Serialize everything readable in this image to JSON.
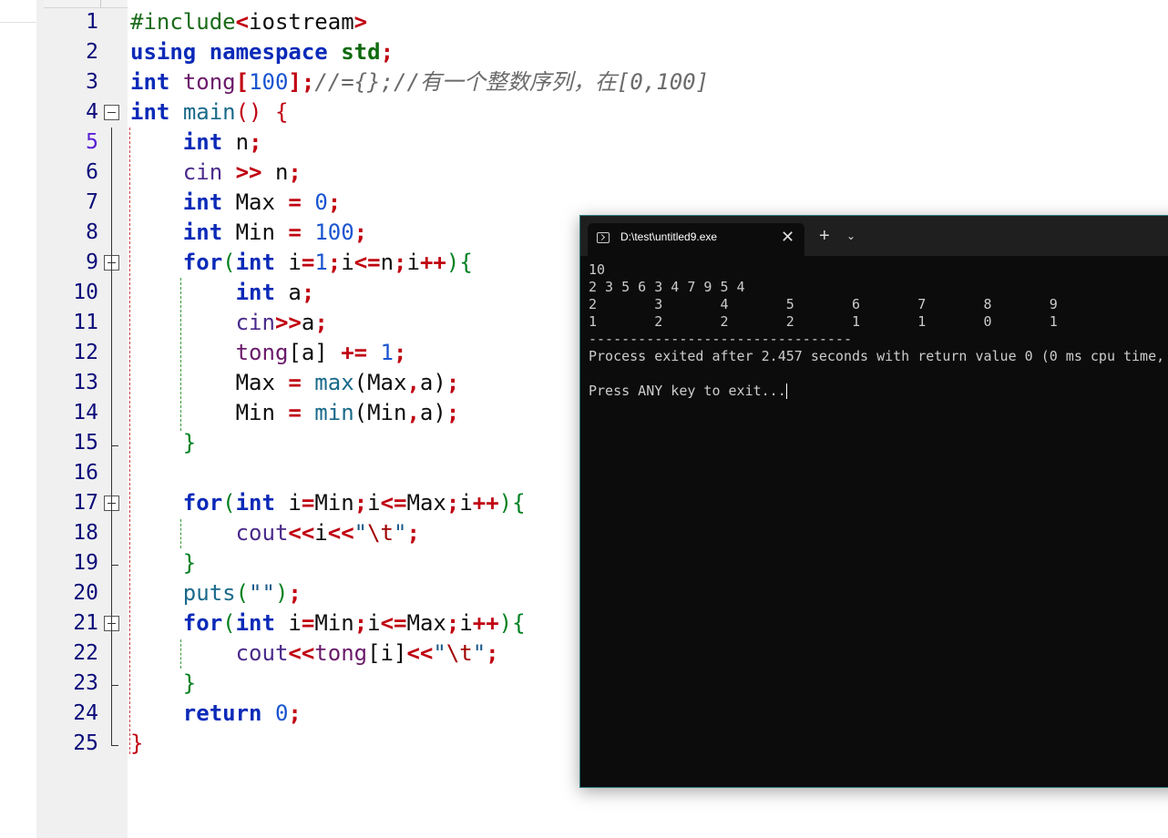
{
  "editor": {
    "lines": [
      {
        "n": "1",
        "tokens": [
          [
            "pp",
            "#include"
          ],
          [
            "op",
            "<"
          ],
          [
            "id",
            "iostream"
          ],
          [
            "op",
            ">"
          ]
        ]
      },
      {
        "n": "2",
        "tokens": [
          [
            "kw",
            "using"
          ],
          [
            "id",
            " "
          ],
          [
            "kw",
            "namespace"
          ],
          [
            "id",
            " "
          ],
          [
            "ns",
            "std"
          ],
          [
            "op",
            ";"
          ]
        ]
      },
      {
        "n": "3",
        "tokens": [
          [
            "kw",
            "int"
          ],
          [
            "id",
            " "
          ],
          [
            "fn",
            "tong"
          ],
          [
            "op",
            "["
          ],
          [
            "num",
            "100"
          ],
          [
            "op",
            "];"
          ],
          [
            "cmt",
            "//={};//有一个整数序列，在[0,100]"
          ]
        ]
      },
      {
        "n": "4",
        "tokens": [
          [
            "kw",
            "int"
          ],
          [
            "id",
            " "
          ],
          [
            "call",
            "main"
          ],
          [
            "br1",
            "()"
          ],
          [
            "id",
            " "
          ],
          [
            "br1",
            "{"
          ]
        ]
      },
      {
        "n": "5",
        "tokens": [
          [
            "id",
            "    "
          ],
          [
            "kw",
            "int"
          ],
          [
            "id",
            " n"
          ],
          [
            "op",
            ";"
          ]
        ]
      },
      {
        "n": "6",
        "tokens": [
          [
            "id",
            "    "
          ],
          [
            "lib",
            "cin"
          ],
          [
            "id",
            " "
          ],
          [
            "op",
            ">>"
          ],
          [
            "id",
            " n"
          ],
          [
            "op",
            ";"
          ]
        ]
      },
      {
        "n": "7",
        "tokens": [
          [
            "id",
            "    "
          ],
          [
            "kw",
            "int"
          ],
          [
            "id",
            " Max "
          ],
          [
            "op",
            "="
          ],
          [
            "id",
            " "
          ],
          [
            "num",
            "0"
          ],
          [
            "op",
            ";"
          ]
        ]
      },
      {
        "n": "8",
        "tokens": [
          [
            "id",
            "    "
          ],
          [
            "kw",
            "int"
          ],
          [
            "id",
            " Min "
          ],
          [
            "op",
            "="
          ],
          [
            "id",
            " "
          ],
          [
            "num",
            "100"
          ],
          [
            "op",
            ";"
          ]
        ]
      },
      {
        "n": "9",
        "tokens": [
          [
            "id",
            "    "
          ],
          [
            "kw",
            "for"
          ],
          [
            "br2",
            "("
          ],
          [
            "kw",
            "int"
          ],
          [
            "id",
            " i"
          ],
          [
            "op",
            "="
          ],
          [
            "num",
            "1"
          ],
          [
            "op",
            ";"
          ],
          [
            "id",
            "i"
          ],
          [
            "op",
            "<="
          ],
          [
            "id",
            "n"
          ],
          [
            "op",
            ";"
          ],
          [
            "id",
            "i"
          ],
          [
            "op",
            "++"
          ],
          [
            "br2",
            ")"
          ],
          [
            "br2",
            "{"
          ]
        ]
      },
      {
        "n": "10",
        "tokens": [
          [
            "id",
            "        "
          ],
          [
            "kw",
            "int"
          ],
          [
            "id",
            " a"
          ],
          [
            "op",
            ";"
          ]
        ]
      },
      {
        "n": "11",
        "tokens": [
          [
            "id",
            "        "
          ],
          [
            "lib",
            "cin"
          ],
          [
            "op",
            ">>"
          ],
          [
            "id",
            "a"
          ],
          [
            "op",
            ";"
          ]
        ]
      },
      {
        "n": "12",
        "tokens": [
          [
            "id",
            "        "
          ],
          [
            "fn",
            "tong"
          ],
          [
            "id",
            "[a] "
          ],
          [
            "op",
            "+="
          ],
          [
            "id",
            " "
          ],
          [
            "num",
            "1"
          ],
          [
            "op",
            ";"
          ]
        ]
      },
      {
        "n": "13",
        "tokens": [
          [
            "id",
            "        Max "
          ],
          [
            "op",
            "="
          ],
          [
            "id",
            " "
          ],
          [
            "call",
            "max"
          ],
          [
            "id",
            "(Max"
          ],
          [
            "op",
            ","
          ],
          [
            "id",
            "a)"
          ],
          [
            "op",
            ";"
          ]
        ]
      },
      {
        "n": "14",
        "tokens": [
          [
            "id",
            "        Min "
          ],
          [
            "op",
            "="
          ],
          [
            "id",
            " "
          ],
          [
            "call",
            "min"
          ],
          [
            "id",
            "(Min"
          ],
          [
            "op",
            ","
          ],
          [
            "id",
            "a)"
          ],
          [
            "op",
            ";"
          ]
        ]
      },
      {
        "n": "15",
        "tokens": [
          [
            "id",
            "    "
          ],
          [
            "br2",
            "}"
          ]
        ]
      },
      {
        "n": "16",
        "tokens": []
      },
      {
        "n": "17",
        "tokens": [
          [
            "id",
            "    "
          ],
          [
            "kw",
            "for"
          ],
          [
            "br2",
            "("
          ],
          [
            "kw",
            "int"
          ],
          [
            "id",
            " i"
          ],
          [
            "op",
            "="
          ],
          [
            "id",
            "Min"
          ],
          [
            "op",
            ";"
          ],
          [
            "id",
            "i"
          ],
          [
            "op",
            "<="
          ],
          [
            "id",
            "Max"
          ],
          [
            "op",
            ";"
          ],
          [
            "id",
            "i"
          ],
          [
            "op",
            "++"
          ],
          [
            "br2",
            ")"
          ],
          [
            "br2",
            "{"
          ]
        ]
      },
      {
        "n": "18",
        "tokens": [
          [
            "id",
            "        "
          ],
          [
            "lib",
            "cout"
          ],
          [
            "op",
            "<<"
          ],
          [
            "id",
            "i"
          ],
          [
            "op",
            "<<"
          ],
          [
            "str",
            "\""
          ],
          [
            "esc",
            "\\t"
          ],
          [
            "str",
            "\""
          ],
          [
            "op",
            ";"
          ]
        ]
      },
      {
        "n": "19",
        "tokens": [
          [
            "id",
            "    "
          ],
          [
            "br2",
            "}"
          ]
        ]
      },
      {
        "n": "20",
        "tokens": [
          [
            "id",
            "    "
          ],
          [
            "call",
            "puts"
          ],
          [
            "br2",
            "("
          ],
          [
            "str",
            "\"\""
          ],
          [
            "br2",
            ")"
          ],
          [
            "op",
            ";"
          ]
        ]
      },
      {
        "n": "21",
        "tokens": [
          [
            "id",
            "    "
          ],
          [
            "kw",
            "for"
          ],
          [
            "br2",
            "("
          ],
          [
            "kw",
            "int"
          ],
          [
            "id",
            " i"
          ],
          [
            "op",
            "="
          ],
          [
            "id",
            "Min"
          ],
          [
            "op",
            ";"
          ],
          [
            "id",
            "i"
          ],
          [
            "op",
            "<="
          ],
          [
            "id",
            "Max"
          ],
          [
            "op",
            ";"
          ],
          [
            "id",
            "i"
          ],
          [
            "op",
            "++"
          ],
          [
            "br2",
            ")"
          ],
          [
            "br2",
            "{"
          ]
        ]
      },
      {
        "n": "22",
        "tokens": [
          [
            "id",
            "        "
          ],
          [
            "lib",
            "cout"
          ],
          [
            "op",
            "<<"
          ],
          [
            "fn",
            "tong"
          ],
          [
            "id",
            "[i]"
          ],
          [
            "op",
            "<<"
          ],
          [
            "str",
            "\""
          ],
          [
            "esc",
            "\\t"
          ],
          [
            "str",
            "\""
          ],
          [
            "op",
            ";"
          ]
        ]
      },
      {
        "n": "23",
        "tokens": [
          [
            "id",
            "    "
          ],
          [
            "br2",
            "}"
          ]
        ]
      },
      {
        "n": "24",
        "tokens": [
          [
            "id",
            "    "
          ],
          [
            "kw",
            "return"
          ],
          [
            "id",
            " "
          ],
          [
            "num",
            "0"
          ],
          [
            "op",
            ";"
          ]
        ]
      },
      {
        "n": "25",
        "tokens": [
          [
            "br1",
            "}"
          ]
        ]
      }
    ],
    "active_line": "5",
    "fold_lines": [
      "4",
      "9",
      "17",
      "21"
    ]
  },
  "console": {
    "tab_title": "D:\\test\\untitled9.exe",
    "close_glyph": "✕",
    "newtab_glyph": "+",
    "dropdown_glyph": "⌄",
    "output": [
      "10",
      "2 3 5 6 3 4 7 9 5 4",
      "2       3       4       5       6       7       8       9",
      "1       2       2       2       1       1       0       1",
      "--------------------------------",
      "Process exited after 2.457 seconds with return value 0 (0 ms cpu time,",
      "",
      "Press ANY key to exit..."
    ]
  },
  "colors": {
    "keyword": "#0a2ab8",
    "operator": "#c00010",
    "number": "#1a55d0",
    "comment": "#6a6a6a",
    "line_highlight": "#fffbe6",
    "console_bg": "#0c0c0c"
  }
}
